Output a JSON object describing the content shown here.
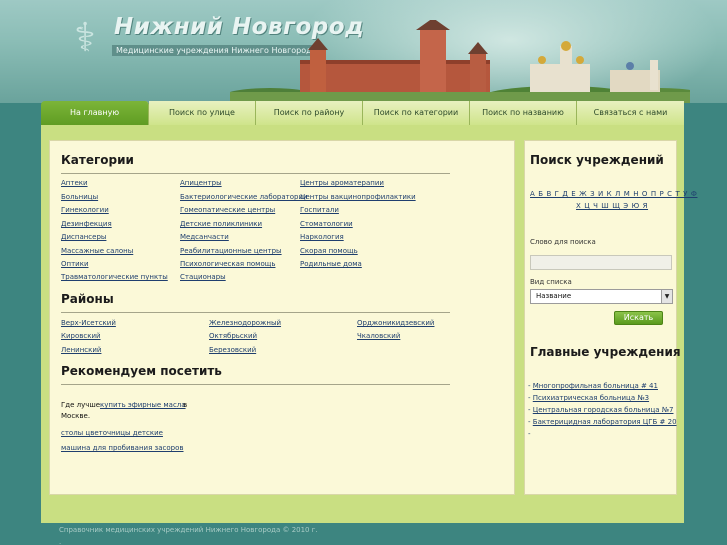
{
  "header": {
    "title": "Нижний Новгород",
    "subtitle": "Медицинские учреждения Нижнего Новгорода",
    "logo_icon": "caduceus-icon"
  },
  "nav": {
    "items": [
      {
        "label": "На главную",
        "active": true
      },
      {
        "label": "Поиск по улице",
        "active": false
      },
      {
        "label": "Поиск по району",
        "active": false
      },
      {
        "label": "Поиск по категории",
        "active": false
      },
      {
        "label": "Поиск по названию",
        "active": false
      },
      {
        "label": "Связаться с нами",
        "active": false
      }
    ]
  },
  "categories": {
    "heading": "Категории",
    "col1": [
      "Аптеки",
      "Больницы",
      "Гинекологии",
      "Дезинфекция",
      "Диспансеры",
      "Массажные салоны",
      "Оптики",
      "Травматологические пункты"
    ],
    "col2": [
      "Апицентры",
      "Бактериологические лаборатории",
      "Гомеопатические центры",
      "Детские поликлиники",
      "Медсанчасти",
      "Реабилитационные центры",
      "Психологическая помощь",
      "Стационары"
    ],
    "col3": [
      "Центры ароматерапии",
      "Центры вакцинопрофилактики",
      "Госпитали",
      "Стоматологии",
      "Наркология",
      "Скорая помощь",
      "Родильные дома"
    ]
  },
  "districts": {
    "heading": "Районы",
    "col1": [
      "Верх-Исетский",
      "Кировский",
      "Ленинский"
    ],
    "col2": [
      "Железнодорожный",
      "Октябрьский",
      "Березовский"
    ],
    "col3": [
      "Орджоникидзевский",
      "Чкаловский"
    ]
  },
  "recommend": {
    "heading": "Рекомендуем посетить",
    "line1_prefix": "Где лучше",
    "line1_link": "купить эфирные масла",
    "line1_suffix": "в",
    "line2": "Москве.",
    "link2": "столы цветочницы детские",
    "link3": "машина для пробивания засоров"
  },
  "search": {
    "heading": "Поиск учреждений",
    "alphabet_row1": "А Б В Г Д Е Ж З И К Л М Н О П Р С Т У Ф",
    "alphabet_row2": "Х Ц Ч Ш Щ Э Ю Я",
    "word_label": "Слово для поиска",
    "word_value": "",
    "view_label": "Вид списка",
    "view_selected": "Название",
    "button": "Искать"
  },
  "main_institutions": {
    "heading": "Главные учреждения",
    "items": [
      "Многопрофильная больница # 41",
      "Психиатрическая больница №3",
      "Центральная городская больница №7",
      "Бактерицидная лаборатория ЦГБ # 20",
      ""
    ]
  },
  "footer": {
    "text": "Справочник медицинских учреждений Нижнего Новгорода © 2010 г.",
    "dot": "·"
  },
  "colors": {
    "nav_active": "#6aa82c",
    "nav_inactive": "#d8e9a0",
    "panel": "#fbf9d8",
    "link": "#1f3f6e",
    "page_bg": "#3d8580"
  }
}
